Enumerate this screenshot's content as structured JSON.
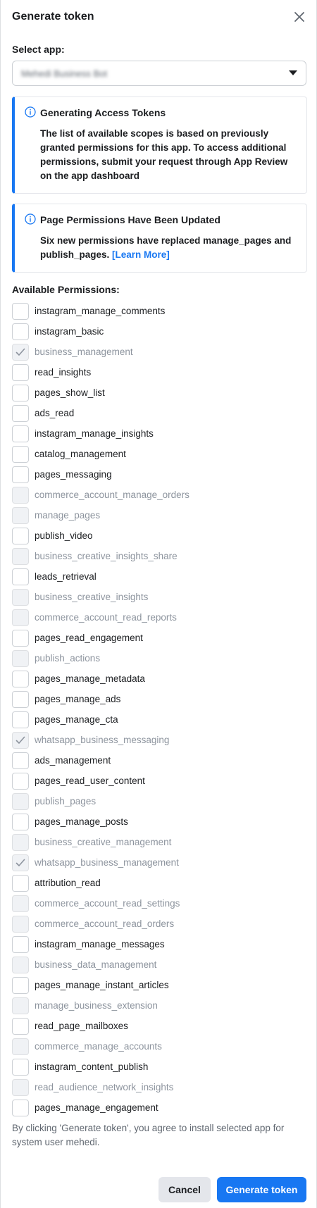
{
  "dialog": {
    "title": "Generate token",
    "close_icon": "close-icon"
  },
  "select_app": {
    "label": "Select app:",
    "value": "Mehedi Business Bot",
    "dropdown_icon": "caret-down-icon"
  },
  "notices": [
    {
      "title": "Generating Access Tokens",
      "body": "The list of available scopes is based on previously granted permissions for this app. To access additional permissions, submit your request through App Review on the app dashboard",
      "icon": "info-icon"
    },
    {
      "title": "Page Permissions Have Been Updated",
      "body": "Six new permissions have replaced manage_pages and publish_pages.",
      "link": "[Learn More]",
      "icon": "info-icon"
    }
  ],
  "permissions_label": "Available Permissions:",
  "permissions": [
    {
      "name": "instagram_manage_comments",
      "checked": false,
      "disabled": false
    },
    {
      "name": "instagram_basic",
      "checked": false,
      "disabled": false
    },
    {
      "name": "business_management",
      "checked": true,
      "disabled": true
    },
    {
      "name": "read_insights",
      "checked": false,
      "disabled": false
    },
    {
      "name": "pages_show_list",
      "checked": false,
      "disabled": false
    },
    {
      "name": "ads_read",
      "checked": false,
      "disabled": false
    },
    {
      "name": "instagram_manage_insights",
      "checked": false,
      "disabled": false
    },
    {
      "name": "catalog_management",
      "checked": false,
      "disabled": false
    },
    {
      "name": "pages_messaging",
      "checked": false,
      "disabled": false
    },
    {
      "name": "commerce_account_manage_orders",
      "checked": false,
      "disabled": true
    },
    {
      "name": "manage_pages",
      "checked": false,
      "disabled": true
    },
    {
      "name": "publish_video",
      "checked": false,
      "disabled": false
    },
    {
      "name": "business_creative_insights_share",
      "checked": false,
      "disabled": true
    },
    {
      "name": "leads_retrieval",
      "checked": false,
      "disabled": false
    },
    {
      "name": "business_creative_insights",
      "checked": false,
      "disabled": true
    },
    {
      "name": "commerce_account_read_reports",
      "checked": false,
      "disabled": true
    },
    {
      "name": "pages_read_engagement",
      "checked": false,
      "disabled": false
    },
    {
      "name": "publish_actions",
      "checked": false,
      "disabled": true
    },
    {
      "name": "pages_manage_metadata",
      "checked": false,
      "disabled": false
    },
    {
      "name": "pages_manage_ads",
      "checked": false,
      "disabled": false
    },
    {
      "name": "pages_manage_cta",
      "checked": false,
      "disabled": false
    },
    {
      "name": "whatsapp_business_messaging",
      "checked": true,
      "disabled": true
    },
    {
      "name": "ads_management",
      "checked": false,
      "disabled": false
    },
    {
      "name": "pages_read_user_content",
      "checked": false,
      "disabled": false
    },
    {
      "name": "publish_pages",
      "checked": false,
      "disabled": true
    },
    {
      "name": "pages_manage_posts",
      "checked": false,
      "disabled": false
    },
    {
      "name": "business_creative_management",
      "checked": false,
      "disabled": true
    },
    {
      "name": "whatsapp_business_management",
      "checked": true,
      "disabled": true
    },
    {
      "name": "attribution_read",
      "checked": false,
      "disabled": false
    },
    {
      "name": "commerce_account_read_settings",
      "checked": false,
      "disabled": true
    },
    {
      "name": "commerce_account_read_orders",
      "checked": false,
      "disabled": true
    },
    {
      "name": "instagram_manage_messages",
      "checked": false,
      "disabled": false
    },
    {
      "name": "business_data_management",
      "checked": false,
      "disabled": true
    },
    {
      "name": "pages_manage_instant_articles",
      "checked": false,
      "disabled": false
    },
    {
      "name": "manage_business_extension",
      "checked": false,
      "disabled": true
    },
    {
      "name": "read_page_mailboxes",
      "checked": false,
      "disabled": false
    },
    {
      "name": "commerce_manage_accounts",
      "checked": false,
      "disabled": true
    },
    {
      "name": "instagram_content_publish",
      "checked": false,
      "disabled": false
    },
    {
      "name": "read_audience_network_insights",
      "checked": false,
      "disabled": true
    },
    {
      "name": "pages_manage_engagement",
      "checked": false,
      "disabled": false
    }
  ],
  "footer": {
    "consent_text": "By clicking 'Generate token', you agree to install selected app for system user mehedi.",
    "cancel_label": "Cancel",
    "generate_label": "Generate token"
  },
  "colors": {
    "accent": "#1877f2",
    "disabled_text": "#8d949e"
  }
}
